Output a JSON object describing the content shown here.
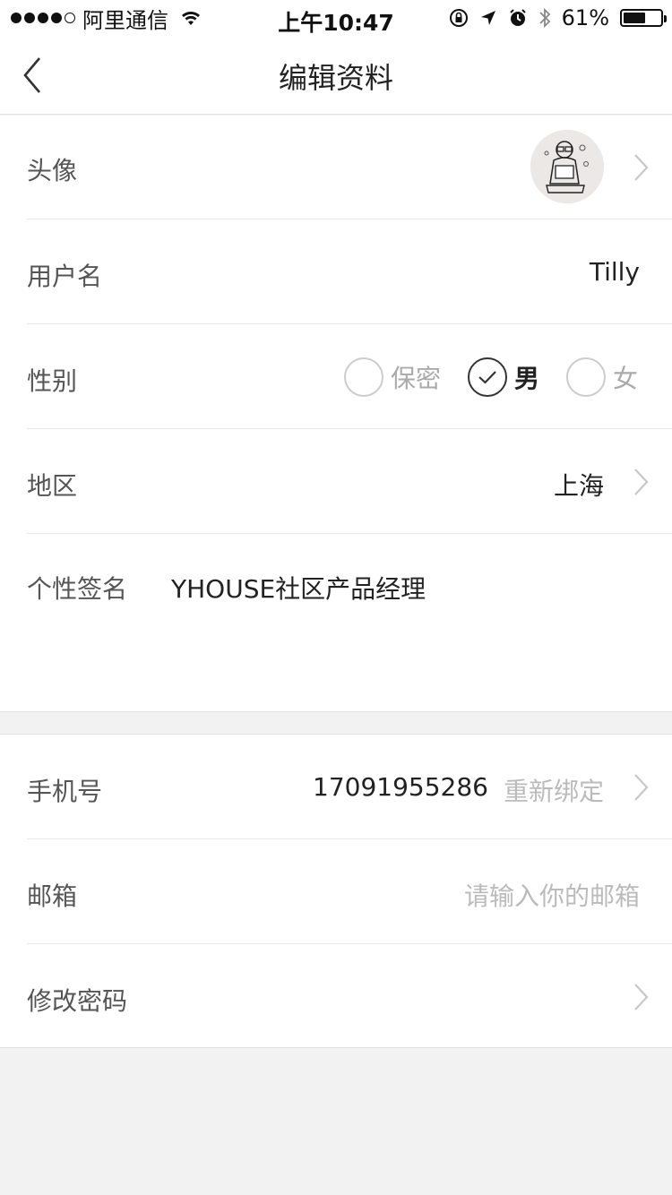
{
  "status_bar": {
    "carrier": "阿里通信",
    "time": "上午10:47",
    "battery": "61%",
    "battery_level": 0.61
  },
  "nav": {
    "title": "编辑资料",
    "back_icon": "chevron-left-icon"
  },
  "profile": {
    "avatar_label": "头像",
    "username_label": "用户名",
    "username_value": "Tilly",
    "gender_label": "性别",
    "gender_options": [
      "保密",
      "男",
      "女"
    ],
    "gender_selected": "男",
    "region_label": "地区",
    "region_value": "上海",
    "signature_label": "个性签名",
    "signature_value": "YHOUSE社区产品经理"
  },
  "account": {
    "phone_label": "手机号",
    "phone_value": "17091955286",
    "phone_action": "重新绑定",
    "email_label": "邮箱",
    "email_placeholder": "请输入你的邮箱",
    "password_label": "修改密码"
  },
  "colors": {
    "background": "#f2f2f2",
    "surface": "#ffffff",
    "divider": "#e8e8e8",
    "text_primary": "#222222",
    "text_secondary": "#555555",
    "text_placeholder": "#bbbbbb"
  }
}
